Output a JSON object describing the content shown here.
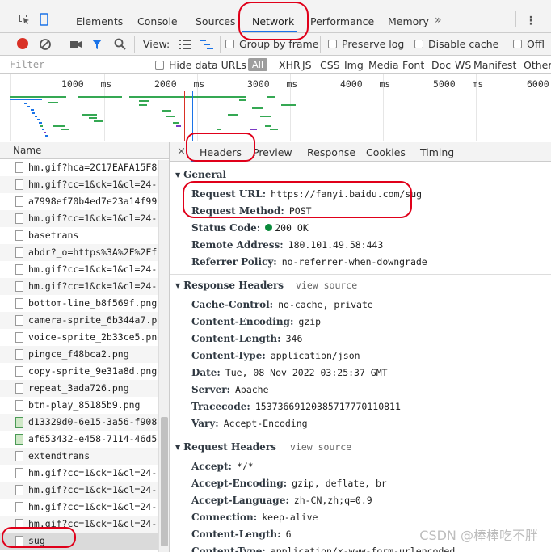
{
  "tabs": {
    "items": [
      "Elements",
      "Console",
      "Sources",
      "Network",
      "Performance",
      "Memory"
    ],
    "more": "»",
    "menu": "⋮"
  },
  "toolbar": {
    "view_label": "View:",
    "group_by_frame": "Group by frame",
    "preserve_log": "Preserve log",
    "disable_cache": "Disable cache",
    "offline": "Offl"
  },
  "filter": {
    "placeholder": "Filter",
    "hide_data_urls": "Hide data URLs",
    "types": [
      "All",
      "XHR",
      "JS",
      "CSS",
      "Img",
      "Media",
      "Font",
      "Doc",
      "WS",
      "Manifest",
      "Other"
    ]
  },
  "overview": {
    "ticks": [
      {
        "value": "1000",
        "unit": "ms"
      },
      {
        "value": "2000",
        "unit": "ms"
      },
      {
        "value": "3000",
        "unit": "ms"
      },
      {
        "value": "4000",
        "unit": "ms"
      },
      {
        "value": "5000",
        "unit": "ms"
      },
      {
        "value": "6000",
        "unit": ""
      }
    ]
  },
  "requests": {
    "header": "Name",
    "rows": [
      {
        "name": "hm.gif?hca=2C17EAFA15F8E",
        "type": "doc"
      },
      {
        "name": "hm.gif?cc=1&ck=1&cl=24-b",
        "type": "doc"
      },
      {
        "name": "a7998ef70b4ed7e23a14f99b",
        "type": "doc"
      },
      {
        "name": "hm.gif?cc=1&ck=1&cl=24-b",
        "type": "doc"
      },
      {
        "name": "basetrans",
        "type": "doc"
      },
      {
        "name": "abdr?_o=https%3A%2F%2Ffa",
        "type": "doc"
      },
      {
        "name": "hm.gif?cc=1&ck=1&cl=24-b",
        "type": "doc"
      },
      {
        "name": "hm.gif?cc=1&ck=1&cl=24-b",
        "type": "doc"
      },
      {
        "name": "bottom-line_b8f569f.png",
        "type": "doc"
      },
      {
        "name": "camera-sprite_6b344a7.png",
        "type": "doc"
      },
      {
        "name": "voice-sprite_2b33ce5.png",
        "type": "doc"
      },
      {
        "name": "pingce_f48bca2.png",
        "type": "doc"
      },
      {
        "name": "copy-sprite_9e31a8d.png",
        "type": "doc"
      },
      {
        "name": "repeat_3ada726.png",
        "type": "doc"
      },
      {
        "name": "btn-play_85185b9.png",
        "type": "doc"
      },
      {
        "name": "d13329d0-6e15-3a56-f908-",
        "type": "img"
      },
      {
        "name": "af653432-e458-7114-46d5-",
        "type": "img"
      },
      {
        "name": "extendtrans",
        "type": "doc"
      },
      {
        "name": "hm.gif?cc=1&ck=1&cl=24-b",
        "type": "doc"
      },
      {
        "name": "hm.gif?cc=1&ck=1&cl=24-b",
        "type": "doc"
      },
      {
        "name": "hm.gif?cc=1&ck=1&cl=24-b",
        "type": "doc"
      },
      {
        "name": "hm.gif?cc=1&ck=1&cl=24-b",
        "type": "doc"
      },
      {
        "name": "sug",
        "type": "doc"
      }
    ]
  },
  "detail_tabs": {
    "close": "×",
    "items": [
      "Headers",
      "Preview",
      "Response",
      "Cookies",
      "Timing"
    ]
  },
  "general": {
    "title": "General",
    "request_url_key": "Request URL:",
    "request_url": "https://fanyi.baidu.com/sug",
    "request_method_key": "Request Method:",
    "request_method": "POST",
    "status_code_key": "Status Code:",
    "status_code": "200 OK",
    "remote_address_key": "Remote Address:",
    "remote_address": "180.101.49.58:443",
    "referrer_policy_key": "Referrer Policy:",
    "referrer_policy": "no-referrer-when-downgrade"
  },
  "response_headers": {
    "title": "Response Headers",
    "view_source": "view source",
    "items": [
      {
        "k": "Cache-Control:",
        "v": "no-cache, private"
      },
      {
        "k": "Content-Encoding:",
        "v": "gzip"
      },
      {
        "k": "Content-Length:",
        "v": "346"
      },
      {
        "k": "Content-Type:",
        "v": "application/json"
      },
      {
        "k": "Date:",
        "v": "Tue, 08 Nov 2022 03:25:37 GMT"
      },
      {
        "k": "Server:",
        "v": "Apache"
      },
      {
        "k": "Tracecode:",
        "v": "15373669120385717770110811"
      },
      {
        "k": "Vary:",
        "v": "Accept-Encoding"
      }
    ]
  },
  "request_headers": {
    "title": "Request Headers",
    "view_source": "view source",
    "items": [
      {
        "k": "Accept:",
        "v": "*/*"
      },
      {
        "k": "Accept-Encoding:",
        "v": "gzip, deflate, br"
      },
      {
        "k": "Accept-Language:",
        "v": "zh-CN,zh;q=0.9"
      },
      {
        "k": "Connection:",
        "v": "keep-alive"
      },
      {
        "k": "Content-Length:",
        "v": "6"
      },
      {
        "k": "Content-Type:",
        "v": "application/x-www-form-urlencoded"
      }
    ]
  },
  "watermark": "CSDN @棒棒吃不胖",
  "colors": {
    "accent": "#1a73e8",
    "record": "#d93025",
    "annotation": "#e0001a",
    "status_ok": "#0b8a3b"
  }
}
